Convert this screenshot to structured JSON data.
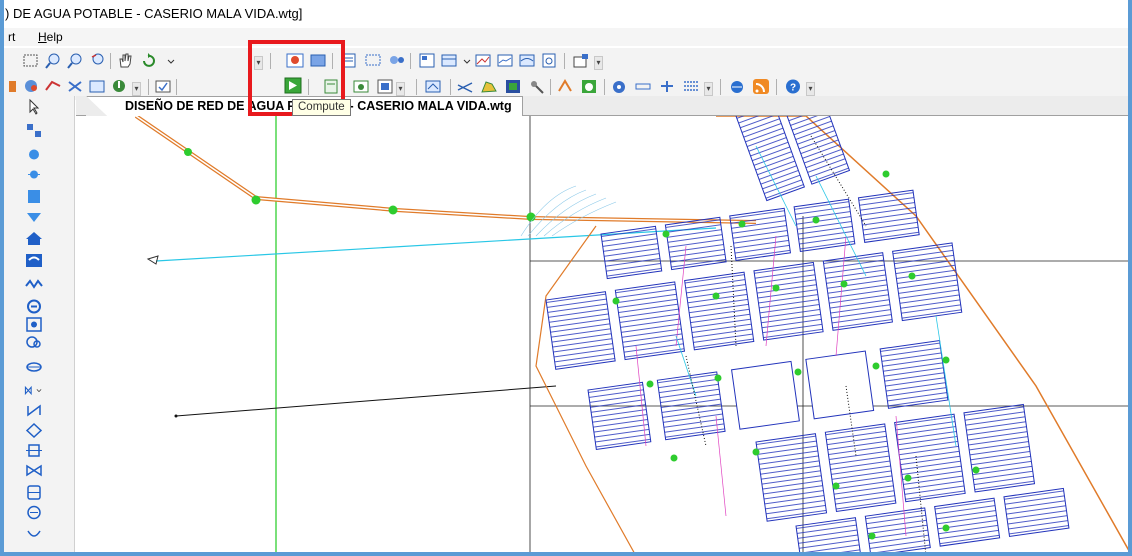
{
  "window": {
    "title": ") DE AGUA POTABLE - CASERIO MALA VIDA.wtg]"
  },
  "menu": {
    "items": [
      {
        "label": "rt"
      },
      {
        "label": "Help",
        "accel": "H",
        "rest": "elp"
      }
    ]
  },
  "toolbar": {
    "compute_tooltip": "Compute"
  },
  "document": {
    "tab_title": "DISEÑO DE RED DE AGUA POTABLE - CASERIO MALA VIDA.wtg"
  },
  "colors": {
    "highlight_box": "#e8191d",
    "pipe_main": "#e07b2a",
    "node": "#2ecc2e",
    "guide_line": "#22cc22",
    "cyan_line": "#29c7e6",
    "block_fill": "#2233bb",
    "frame_border": "#5b9bd5"
  }
}
